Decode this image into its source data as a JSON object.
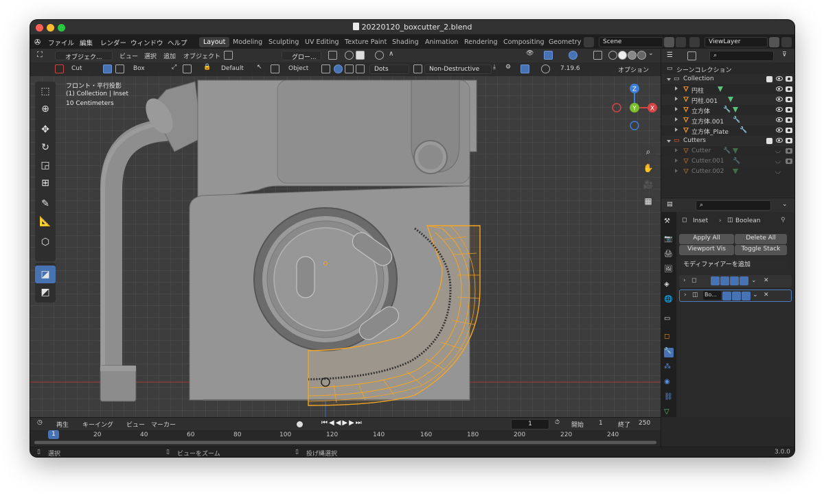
{
  "window": {
    "title": "20220120_boxcutter_2.blend"
  },
  "menubar": {
    "menus": [
      "ファイル",
      "編集",
      "レンダー",
      "ウィンドウ",
      "ヘルプ"
    ],
    "workspaces": [
      "Layout",
      "Modeling",
      "Sculpting",
      "UV Editing",
      "Texture Paint",
      "Shading",
      "Animation",
      "Rendering",
      "Compositing",
      "Geometry"
    ],
    "active_workspace": "Layout",
    "scene": "Scene",
    "view_layer": "ViewLayer"
  },
  "viewport": {
    "header": {
      "mode": "オブジェク...",
      "menus": [
        "ビュー",
        "選択",
        "追加",
        "オブジェクト"
      ],
      "transform_orientation": "グロー..."
    },
    "tool_header": {
      "operation": "Cut",
      "shape": "Box",
      "behavior": "Default",
      "target": "Object",
      "mode": "Dots",
      "boolean_mode": "Non-Destructive",
      "version": "7.19.6",
      "options": "オプション"
    },
    "overlay": {
      "view_name": "フロント・平行投影",
      "collection": "(1) Collection | Inset",
      "grid_scale": "10 Centimeters"
    },
    "gizmo": {
      "z": "Z",
      "x": "X",
      "y": "Y"
    },
    "colors": {
      "selection": "#f5a623",
      "x_axis": "#d64444",
      "y_axis": "#7bbf2c",
      "z_axis": "#3d7ed8"
    }
  },
  "outliner": {
    "root": "シーンコレクション",
    "items": [
      {
        "name": "Collection",
        "type": "collection"
      },
      {
        "name": "円柱",
        "type": "mesh"
      },
      {
        "name": "円柱.001",
        "type": "mesh"
      },
      {
        "name": "立方体",
        "type": "mesh"
      },
      {
        "name": "立方体.001",
        "type": "mesh"
      },
      {
        "name": "立方体_Plate",
        "type": "mesh"
      },
      {
        "name": "Cutters",
        "type": "collection"
      },
      {
        "name": "Cutter",
        "type": "mesh"
      },
      {
        "name": "Cutter.001",
        "type": "mesh"
      },
      {
        "name": "Cutter.002",
        "type": "mesh"
      }
    ]
  },
  "properties": {
    "breadcrumb": [
      "Inset",
      "Boolean"
    ],
    "buttons": {
      "apply_all": "Apply All",
      "delete_all": "Delete All",
      "viewport_vis": "Viewport Vis",
      "toggle_stack": "Toggle Stack"
    },
    "add_modifier": "モディファイアーを追加",
    "modifiers": [
      {
        "name": ""
      },
      {
        "name": "Bo..."
      }
    ]
  },
  "timeline": {
    "menus": [
      "再生",
      "キーイング",
      "ビュー",
      "マーカー"
    ],
    "current_frame": "1",
    "start_label": "開始",
    "start": "1",
    "end_label": "終了",
    "end": "250",
    "ticks": [
      "20",
      "40",
      "60",
      "80",
      "100",
      "120",
      "140",
      "160",
      "180",
      "200",
      "220",
      "240"
    ],
    "playhead": "1"
  },
  "statusbar": {
    "select": "選択",
    "zoom": "ビューをズーム",
    "lasso": "投げ縄選択",
    "version": "3.0.0"
  }
}
